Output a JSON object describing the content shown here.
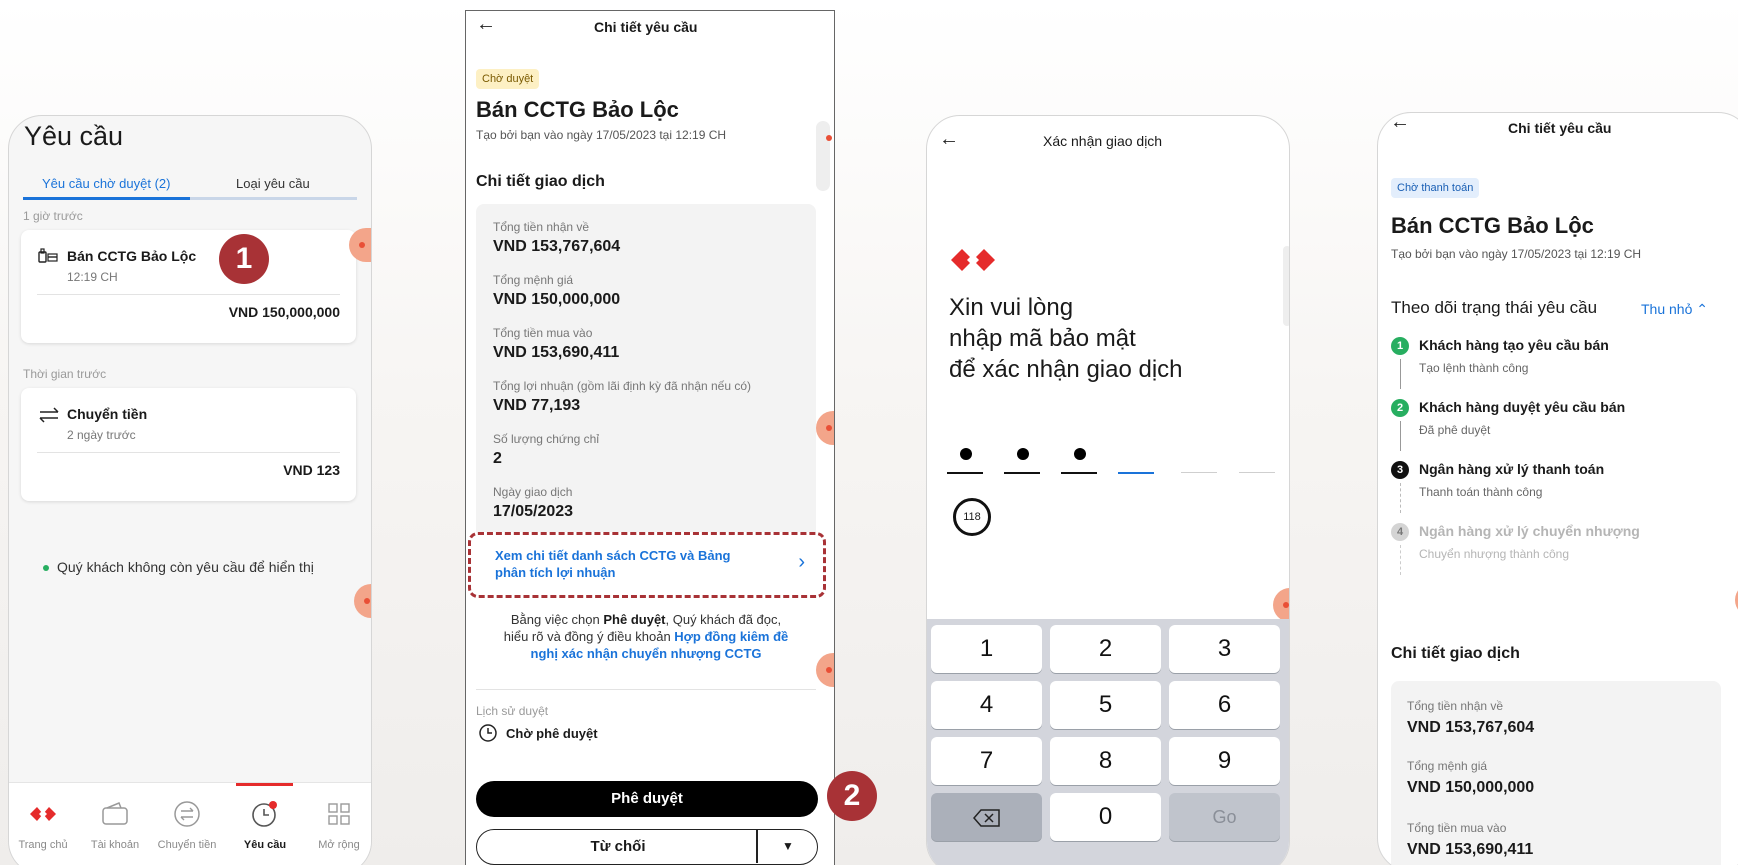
{
  "screen1": {
    "title": "Yêu cầu",
    "tabs": [
      "Yêu cầu chờ duyệt (2)",
      "Loại yêu cầu"
    ],
    "group1_label": "1 giờ trước",
    "card1": {
      "title": "Bán CCTG Bảo Lộc",
      "time": "12:19 CH",
      "amount": "VND 150,000,000",
      "icon": "certificate-icon"
    },
    "group2_label": "Thời gian trước",
    "card2": {
      "title": "Chuyển tiền",
      "time": "2 ngày trước",
      "amount": "VND 123",
      "icon": "transfer-arrows-icon"
    },
    "empty_note": "Quý khách không còn yêu cầu để hiển thị",
    "step_badge": "1",
    "nav": [
      "Trang chủ",
      "Tài khoản",
      "Chuyển tiền",
      "Yêu cầu",
      "Mở rộng"
    ],
    "nav_active": "Yêu cầu"
  },
  "screen2": {
    "header": "Chi tiết yêu cầu",
    "status": "Chờ duyệt",
    "title": "Bán CCTG Bảo Lộc",
    "subtitle": "Tạo bởi bạn vào ngày 17/05/2023 tại 12:19 CH",
    "section": "Chi tiết giao dịch",
    "details": [
      {
        "label": "Tổng tiền nhận về",
        "value": "VND 153,767,604"
      },
      {
        "label": "Tổng mệnh giá",
        "value": "VND 150,000,000"
      },
      {
        "label": "Tổng tiền mua vào",
        "value": "VND 153,690,411"
      },
      {
        "label": "Tổng lợi nhuận (gồm lãi định kỳ đã nhận nếu có)",
        "value": "VND 77,193"
      },
      {
        "label": "Số lượng chứng chỉ",
        "value": "2"
      },
      {
        "label": "Ngày giao dịch",
        "value": "17/05/2023"
      }
    ],
    "link_line1": "Xem chi tiết danh sách CCTG và Bảng",
    "link_line2": "phân tích lợi nhuận",
    "legal_prefix": "Bằng việc chọn ",
    "legal_bold": "Phê duyệt",
    "legal_mid": ", Quý khách đã đọc,",
    "legal_line2": "hiểu rõ và đồng ý điều khoản ",
    "legal_link1": "Hợp đồng kiêm đề",
    "legal_link2": "nghị xác nhận chuyển nhượng CCTG",
    "history_label": "Lịch sử duyệt",
    "history_value": "Chờ phê duyệt",
    "approve": "Phê duyệt",
    "reject": "Từ chối",
    "step_badge": "2"
  },
  "screen3": {
    "header": "Xác nhận giao dịch",
    "prompt": [
      "Xin vui lòng",
      "nhập mã bảo mật",
      "để xác nhận giao dịch"
    ],
    "timer": "118",
    "keys": [
      "1",
      "2",
      "3",
      "4",
      "5",
      "6",
      "7",
      "8",
      "9",
      "",
      "0",
      "Go"
    ]
  },
  "screen4": {
    "header": "Chi tiết yêu cầu",
    "status": "Chờ thanh toán",
    "title": "Bán CCTG Bảo Lộc",
    "subtitle": "Tạo bởi bạn vào ngày 17/05/2023 tại 12:19 CH",
    "tracking": "Theo dõi trạng thái yêu cầu",
    "collapse": "Thu nhỏ",
    "steps": [
      {
        "n": "1",
        "title": "Khách hàng tạo yêu cầu bán",
        "sub": "Tạo lệnh thành công",
        "color": "#27ae60"
      },
      {
        "n": "2",
        "title": "Khách hàng duyệt yêu cầu bán",
        "sub": "Đã phê duyệt",
        "color": "#27ae60"
      },
      {
        "n": "3",
        "title": "Ngân hàng xử lý thanh toán",
        "sub": "Thanh toán thành công",
        "color": "#111111"
      },
      {
        "n": "4",
        "title": "Ngân hàng xử lý chuyển nhượng",
        "sub": "Chuyển nhượng thành công",
        "color": "#c8c8c8"
      }
    ],
    "section": "Chi tiết giao dịch",
    "details": [
      {
        "label": "Tổng tiền nhận về",
        "value": "VND 153,767,604"
      },
      {
        "label": "Tổng mệnh giá",
        "value": "VND 150,000,000"
      },
      {
        "label": "Tổng tiền mua vào",
        "value": "VND 153,690,411"
      }
    ]
  },
  "colors": {
    "accent_blue": "#1a73d9",
    "brand_red": "#e52b2b",
    "badge_red": "#a83236",
    "success_green": "#27ae60"
  }
}
